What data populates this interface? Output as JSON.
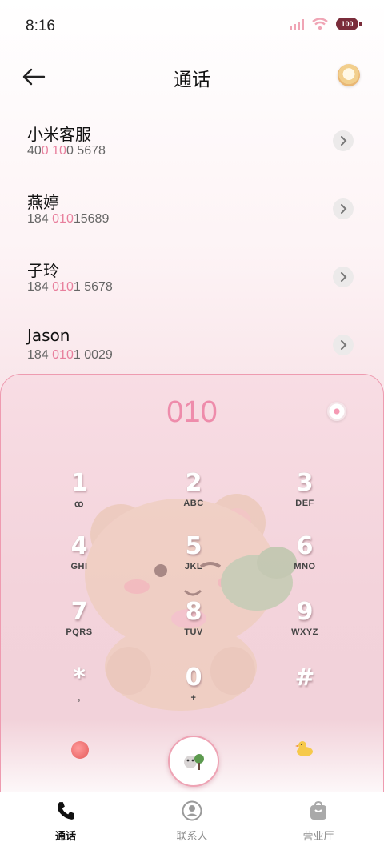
{
  "status": {
    "time": "8:16",
    "battery": "100"
  },
  "header": {
    "title": "通话",
    "back_icon": "arrow-left-icon",
    "theme_icon": "cookie-icon"
  },
  "contacts": [
    {
      "name": "小米客服",
      "num_a": "40",
      "num_hl1": "0",
      "num_b": " ",
      "num_hl2": "10",
      "num_c": "0 5678"
    },
    {
      "name": "燕婷",
      "num_a": "184 ",
      "num_hl1": "010",
      "num_b": "",
      "num_hl2": "",
      "num_c": "15689"
    },
    {
      "name": "子玲",
      "num_a": "184 ",
      "num_hl1": "010",
      "num_b": "",
      "num_hl2": "",
      "num_c": "1 5678"
    },
    {
      "name": "Jason",
      "num_a": "184 ",
      "num_hl1": "010",
      "num_b": "",
      "num_hl2": "",
      "num_c": "1 0029"
    }
  ],
  "dialer": {
    "dialed": "010",
    "keys": [
      {
        "digit": "1",
        "letters": "ꝏ"
      },
      {
        "digit": "2",
        "letters": "ABC"
      },
      {
        "digit": "3",
        "letters": "DEF"
      },
      {
        "digit": "4",
        "letters": "GHI"
      },
      {
        "digit": "5",
        "letters": "JKL"
      },
      {
        "digit": "6",
        "letters": "MNO"
      },
      {
        "digit": "7",
        "letters": "PQRS"
      },
      {
        "digit": "8",
        "letters": "TUV"
      },
      {
        "digit": "9",
        "letters": "WXYZ"
      },
      {
        "digit": "*",
        "letters": ","
      },
      {
        "digit": "0",
        "letters": "+"
      },
      {
        "digit": "#",
        "letters": ""
      }
    ]
  },
  "tabs": [
    {
      "label": "通话",
      "icon": "phone-icon",
      "active": true
    },
    {
      "label": "联系人",
      "icon": "person-icon",
      "active": false
    },
    {
      "label": "营业厅",
      "icon": "shopping-bag-icon",
      "active": false
    }
  ],
  "colors": {
    "accent": "#ee8cab",
    "highlight": "#e87f9d",
    "border": "#ee9bb0"
  }
}
